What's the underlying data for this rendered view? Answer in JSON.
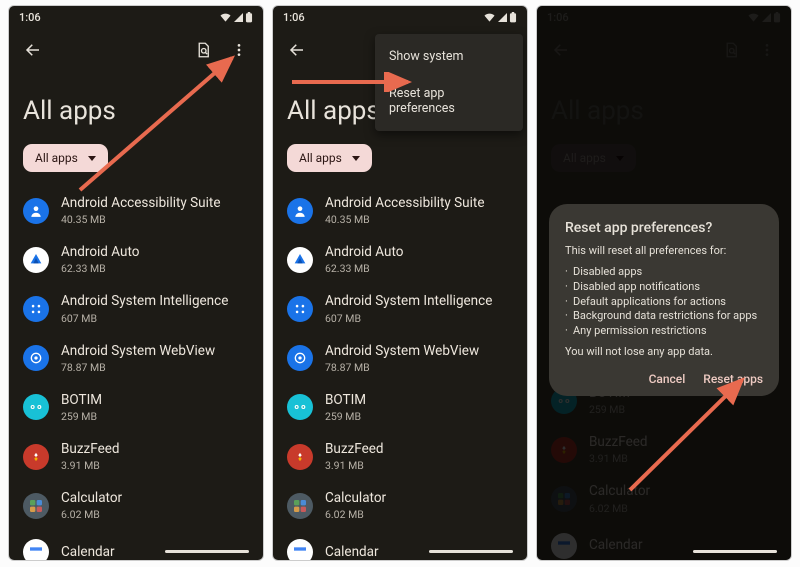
{
  "status": {
    "time": "1:06"
  },
  "header": {
    "title": "All apps",
    "chip_label": "All apps"
  },
  "overflow_menu": {
    "show_system": "Show system",
    "reset_prefs": "Reset app preferences"
  },
  "apps": [
    {
      "name": "Android Accessibility Suite",
      "size": "40.35 MB",
      "icon_bg": "#1a73e8",
      "glyph": "person"
    },
    {
      "name": "Android Auto",
      "size": "62.33 MB",
      "icon_bg": "#ffffff",
      "glyph": "auto"
    },
    {
      "name": "Android System Intelligence",
      "size": "607 MB",
      "icon_bg": "#1a73e8",
      "glyph": "dots"
    },
    {
      "name": "Android System WebView",
      "size": "78.87 MB",
      "icon_bg": "#1a73e8",
      "glyph": "gearweb"
    },
    {
      "name": "BOTIM",
      "size": "259 MB",
      "icon_bg": "#18c1d6",
      "glyph": "eyes"
    },
    {
      "name": "BuzzFeed",
      "size": "3.91 MB",
      "icon_bg": "#c83a2b",
      "glyph": "bf"
    },
    {
      "name": "Calculator",
      "size": "6.02 MB",
      "icon_bg": "#4d5a63",
      "glyph": "calc"
    },
    {
      "name": "Calendar",
      "size": "",
      "icon_bg": "#ffffff",
      "glyph": "cal"
    }
  ],
  "dialog": {
    "title": "Reset app preferences?",
    "lead": "This will reset all preferences for:",
    "bullets": [
      "Disabled apps",
      "Disabled app notifications",
      "Default applications for actions",
      "Background data restrictions for apps",
      "Any permission restrictions"
    ],
    "note": "You will not lose any app data.",
    "cancel": "Cancel",
    "confirm": "Reset apps"
  },
  "phone3_apps_visible": [
    4,
    5,
    6,
    7
  ]
}
